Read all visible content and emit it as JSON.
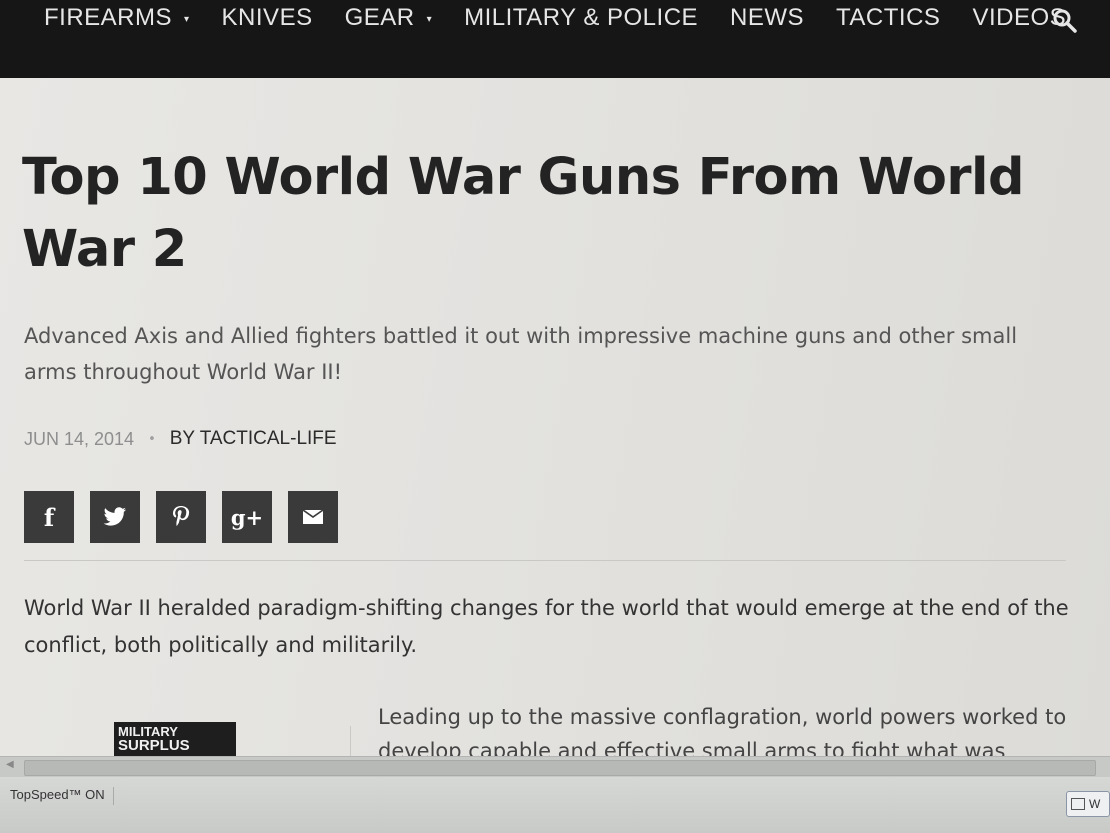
{
  "nav": {
    "items": [
      {
        "label": "FIREARMS",
        "has_caret": true
      },
      {
        "label": "KNIVES",
        "has_caret": false
      },
      {
        "label": "GEAR",
        "has_caret": true
      },
      {
        "label": "MILITARY & POLICE",
        "has_caret": false
      },
      {
        "label": "NEWS",
        "has_caret": false
      },
      {
        "label": "TACTICS",
        "has_caret": false
      },
      {
        "label": "VIDEOS",
        "has_caret": false
      }
    ],
    "caret_glyph": "▾",
    "search_icon": "search-icon"
  },
  "article": {
    "title": "Top 10 World War Guns From World War 2",
    "subtitle": "Advanced Axis and Allied fighters battled it out with impressive machine guns and other small arms throughout World War II!",
    "date": "JUN 14, 2014",
    "meta_separator": "•",
    "author": "BY TACTICAL-LIFE",
    "share": [
      {
        "icon": "facebook-icon",
        "glyph": "f"
      },
      {
        "icon": "twitter-icon",
        "glyph": "t"
      },
      {
        "icon": "pinterest-icon",
        "glyph": "p"
      },
      {
        "icon": "google-plus-icon",
        "glyph": "g+"
      },
      {
        "icon": "email-icon",
        "glyph": "✉"
      }
    ],
    "paragraph_1": "World War II heralded paradigm-shifting changes for the world that would emerge at the end of the conflict, both politically and militarily.",
    "paragraph_2": "Leading up to the massive conflagration, world powers worked to develop capable and effective small arms to fight what was",
    "ad_text_line1": "MILITARY",
    "ad_text_line2": "SURPLUS"
  },
  "status": {
    "topspeed": "TopSpeed™ ON",
    "taskbar_label": "W"
  },
  "colors": {
    "nav_bg": "#161616",
    "share_bg": "#3a3a3a",
    "title_text": "#232323"
  }
}
